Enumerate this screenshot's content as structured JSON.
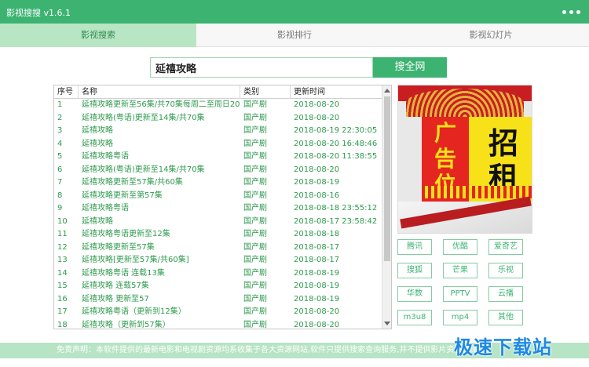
{
  "app": {
    "title": "影视搜搜 v1.6.1"
  },
  "tabs": [
    {
      "label": "影视搜索",
      "active": true
    },
    {
      "label": "影视排行",
      "active": false
    },
    {
      "label": "影视幻灯片",
      "active": false
    }
  ],
  "search": {
    "value": "延禧攻略",
    "button_label": "搜全网"
  },
  "table": {
    "headers": [
      "序号",
      "名称",
      "类别",
      "更新时间"
    ],
    "rows": [
      [
        "1",
        "延禧攻略更新至56集/共70集每周二至周日20...",
        "国产剧",
        "2018-08-20"
      ],
      [
        "2",
        "延禧攻略(粤语)更新至14集/共70集",
        "国产剧",
        "2018-08-20"
      ],
      [
        "3",
        "延禧攻略",
        "国产剧",
        "2018-08-19 22:30:05"
      ],
      [
        "4",
        "延禧攻略",
        "国产剧",
        "2018-08-20 16:48:46"
      ],
      [
        "5",
        "延禧攻略粤语",
        "国产剧",
        "2018-08-20 11:38:55"
      ],
      [
        "6",
        "延禧攻略(粤语)更新至14集/共70集",
        "国产剧",
        "2018-08-20"
      ],
      [
        "7",
        "延禧攻略更新至57集/共60集",
        "国产剧",
        "2018-08-19"
      ],
      [
        "8",
        "延禧攻略更新至第57集",
        "国产剧",
        "2018-08-16"
      ],
      [
        "9",
        "延禧攻略粤语",
        "国产剧",
        "2018-08-18 23:55:12"
      ],
      [
        "10",
        "延禧攻略",
        "国产剧",
        "2018-08-17 23:58:42"
      ],
      [
        "11",
        "延禧攻略粤语更新至12集",
        "国产剧",
        "2018-08-18"
      ],
      [
        "12",
        "延禧攻略更新至57集",
        "国产剧",
        "2018-08-17"
      ],
      [
        "13",
        "延禧攻略[更新至57集/共60集]",
        "国产剧",
        "2018-08-17"
      ],
      [
        "14",
        "延禧攻略粤语 连载13集",
        "国产剧",
        "2018-08-19"
      ],
      [
        "15",
        "延禧攻略 连载57集",
        "国产剧",
        "2018-08-19"
      ],
      [
        "16",
        "延禧攻略 更新至57",
        "国产剧",
        "2018-08-19"
      ],
      [
        "17",
        "延禧攻略粤语（更新到12集）",
        "国产剧",
        "2018-08-20"
      ],
      [
        "18",
        "延禧攻略（更新到57集）",
        "国产剧",
        "2018-08-20"
      ]
    ]
  },
  "ad": {
    "left_chars": [
      "广",
      "告",
      "位"
    ],
    "right_chars": [
      "招",
      "租"
    ]
  },
  "sources": [
    "腾讯",
    "优酷",
    "爱奇艺",
    "搜狐",
    "芒果",
    "乐视",
    "华数",
    "PPTV",
    "云播",
    "m3u8",
    "mp4",
    "其他"
  ],
  "footer": {
    "text": "免责声明：本软件提供的最新电影和电视剧资源均系收集于各大资源网站,软件只提供搜索查询服务,并不提供影片资源存储"
  },
  "watermark": {
    "text": "极速下载站"
  },
  "colors": {
    "accent": "#3cb371",
    "tab_active": "#b8e6c4",
    "footer": "#b7e4c4",
    "watermark": "#1e88e5"
  },
  "icons": {
    "menu": "more-dots-icon"
  }
}
